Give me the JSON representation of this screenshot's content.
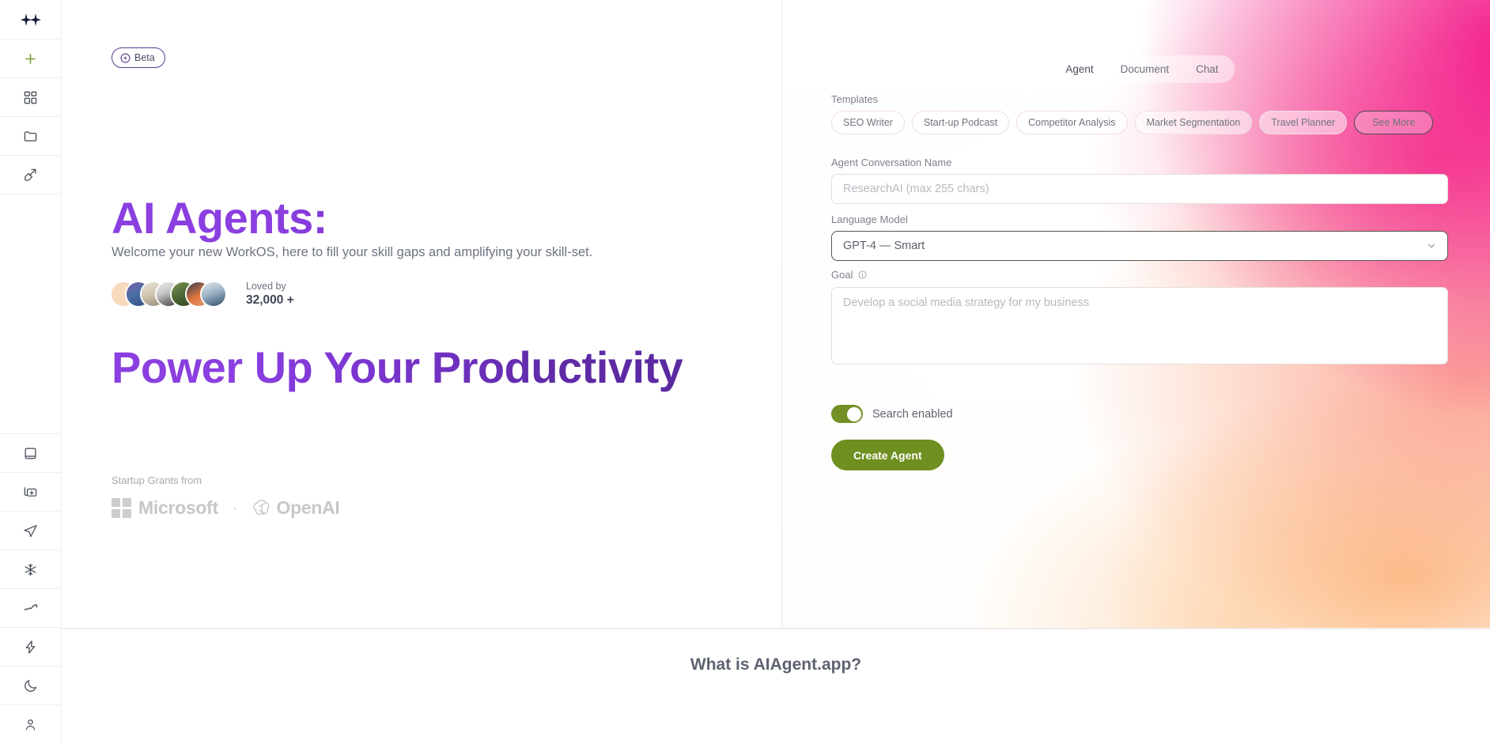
{
  "rail": {
    "logo": {
      "name": "sparkle-logo",
      "glyph": "✦✦"
    },
    "items": [
      {
        "id": "new",
        "icon": "plus-icon",
        "label": "New"
      },
      {
        "id": "dashboard",
        "icon": "grid-icon",
        "label": "Dashboard"
      },
      {
        "id": "files",
        "icon": "folder-icon",
        "label": "Files"
      },
      {
        "id": "tools",
        "icon": "wand-icon",
        "label": "Tools"
      }
    ],
    "bottom_items": [
      {
        "id": "library",
        "icon": "book-icon",
        "label": "Library"
      },
      {
        "id": "duplicate",
        "icon": "add-panel-icon",
        "label": "Add Panel"
      },
      {
        "id": "send",
        "icon": "paper-plane-icon",
        "label": "Send"
      },
      {
        "id": "snowflake",
        "icon": "snowflake-icon",
        "label": "Snowflake"
      },
      {
        "id": "trending",
        "icon": "trending-up-icon",
        "label": "Trending"
      },
      {
        "id": "zap",
        "icon": "lightning-icon",
        "label": "Automations"
      },
      {
        "id": "theme",
        "icon": "moon-icon",
        "label": "Dark Mode"
      },
      {
        "id": "account",
        "icon": "user-icon",
        "label": "Account"
      }
    ]
  },
  "hero": {
    "badge": {
      "label": "Beta",
      "icon": "lightning-bolt-icon"
    },
    "title_line1": "AI Agents:",
    "title_line2": "Power Up Your Productivity",
    "subtitle": "Welcome your new WorkOS, here to fill your skill gaps and amplifying your skill-set.",
    "social_proof": {
      "label": "Loved by",
      "count": "32,000 +",
      "avatar_count": 7
    },
    "grants": {
      "label": "Startup Grants from",
      "microsoft": "Microsoft",
      "separator": "·",
      "openai": "OpenAI"
    }
  },
  "form": {
    "tabs": [
      {
        "label": "Agent",
        "active": true
      },
      {
        "label": "Document",
        "active": false
      },
      {
        "label": "Chat",
        "active": false
      }
    ],
    "templates": {
      "label": "Templates",
      "chips": [
        "SEO Writer",
        "Start-up Podcast",
        "Competitor Analysis",
        "Market Segmentation",
        "Travel Planner"
      ],
      "see_more": "See More"
    },
    "conversation_name": {
      "label": "Agent Conversation Name",
      "placeholder": "ResearchAI (max 255 chars)",
      "value": ""
    },
    "language_model": {
      "label": "Language Model",
      "value": "GPT-4 — Smart",
      "options": [
        "GPT-4 — Smart"
      ],
      "caret_icon": "chevron-down-icon"
    },
    "goal": {
      "label": "Goal",
      "info_icon": "info-icon",
      "placeholder": "Develop a social media strategy for my business",
      "value": ""
    },
    "search_toggle": {
      "label": "Search enabled",
      "enabled": true
    },
    "submit": {
      "label": "Create Agent"
    }
  },
  "bottom": {
    "title": "What is AIAgent.app?"
  },
  "colors": {
    "accent_purple": "#8b3fe0",
    "accent_purple_dark": "#5a2aa0",
    "green": "#6f9020",
    "gradient_magenta": "#f21286",
    "gradient_peach": "#fdba7e",
    "muted_text": "#6d7280"
  }
}
